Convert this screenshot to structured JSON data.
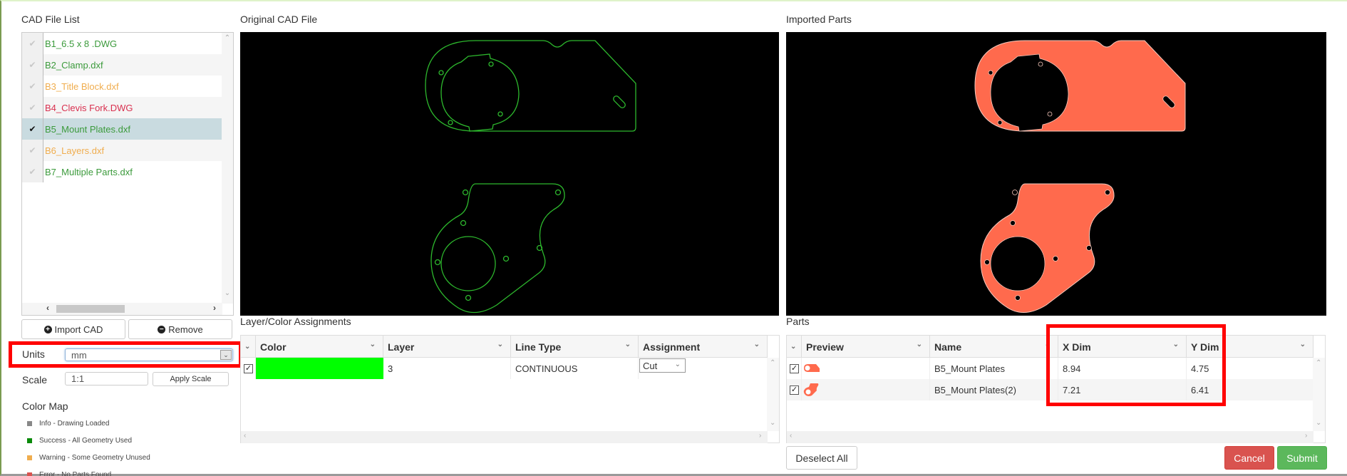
{
  "left_panel": {
    "title": "CAD File List",
    "files": [
      {
        "name": "B1_6.5 x 8 .DWG",
        "status": "success",
        "color": "#3b9a3b",
        "selected": false
      },
      {
        "name": "B2_Clamp.dxf",
        "status": "success",
        "color": "#3b9a3b",
        "selected": false
      },
      {
        "name": "B3_Title Block.dxf",
        "status": "warning",
        "color": "#f0ad4e",
        "selected": false
      },
      {
        "name": "B4_Clevis Fork.DWG",
        "status": "error",
        "color": "#d9304f",
        "selected": false
      },
      {
        "name": "B5_Mount Plates.dxf",
        "status": "success",
        "color": "#3b9a3b",
        "selected": true
      },
      {
        "name": "B6_Layers.dxf",
        "status": "warning",
        "color": "#f0ad4e",
        "selected": false
      },
      {
        "name": "B7_Multiple Parts.dxf",
        "status": "success",
        "color": "#3b9a3b",
        "selected": false
      }
    ],
    "import_label": "Import CAD",
    "remove_label": "Remove",
    "units_label": "Units",
    "units_value": "mm",
    "scale_label": "Scale",
    "scale_value": "1:1",
    "apply_scale_label": "Apply Scale",
    "color_map_title": "Color Map",
    "color_map": [
      {
        "label": "Info - Drawing Loaded",
        "color": "#888888"
      },
      {
        "label": "Success - All Geometry Used",
        "color": "#0a8a0a"
      },
      {
        "label": "Warning - Some Geometry Unused",
        "color": "#f0ad4e"
      },
      {
        "label": "Error - No Parts Found",
        "color": "#d9534f"
      }
    ]
  },
  "original_cad": {
    "title": "Original CAD File",
    "stroke_color": "#2db82d"
  },
  "imported_parts": {
    "title": "Imported Parts",
    "fill_color": "#ff6a4d"
  },
  "layer_assignments": {
    "title": "Layer/Color Assignments",
    "columns": [
      "Color",
      "Layer",
      "Line Type",
      "Assignment"
    ],
    "rows": [
      {
        "checked": true,
        "color": "#00ff00",
        "layer": "3",
        "line_type": "CONTINUOUS",
        "assignment": "Cut"
      }
    ]
  },
  "parts": {
    "title": "Parts",
    "columns": [
      "Preview",
      "Name",
      "X Dim",
      "Y Dim"
    ],
    "rows": [
      {
        "checked": true,
        "name": "B5_Mount Plates",
        "x_dim": "8.94",
        "y_dim": "4.75"
      },
      {
        "checked": true,
        "name": "B5_Mount Plates(2)",
        "x_dim": "7.21",
        "y_dim": "6.41"
      }
    ]
  },
  "footer": {
    "deselect_all_label": "Deselect All",
    "cancel_label": "Cancel",
    "submit_label": "Submit"
  },
  "highlight_color": "#ff0000"
}
